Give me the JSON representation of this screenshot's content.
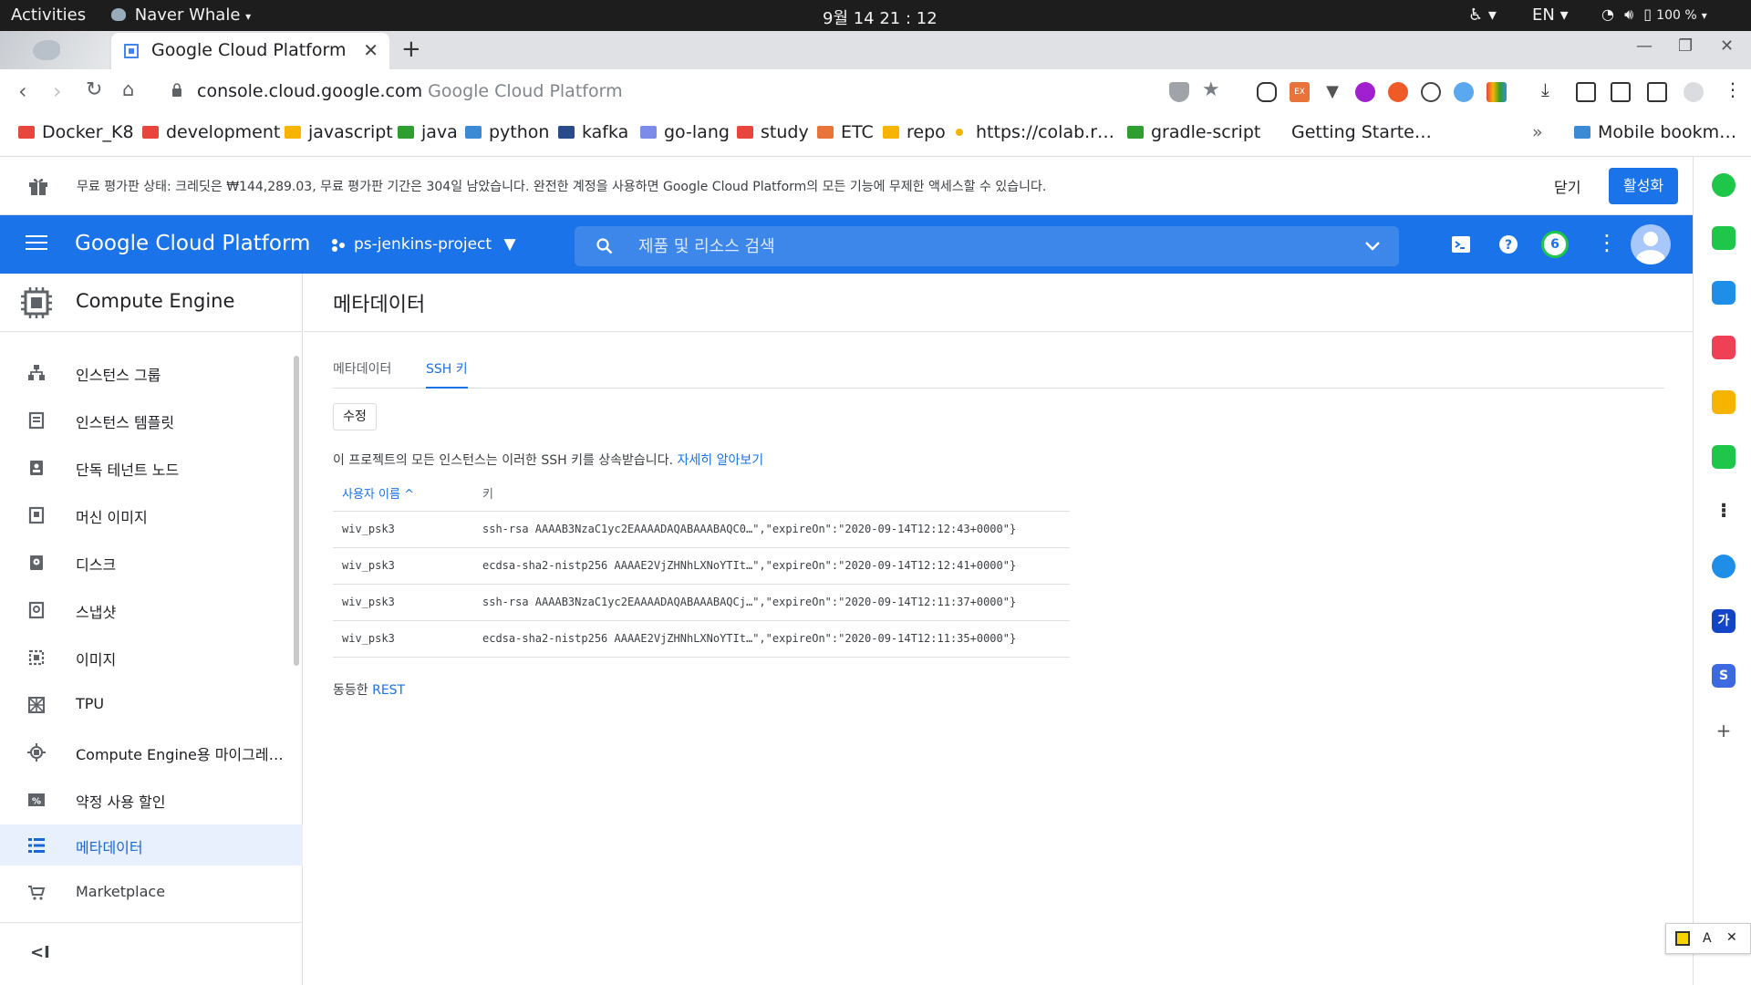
{
  "system": {
    "activities": "Activities",
    "app": "Naver Whale",
    "clock": "9월 14  21 : 12",
    "lang": "EN",
    "battery": "100 %"
  },
  "browser": {
    "tab_title": "Google Cloud Platform",
    "url_host": "console.cloud.google.com",
    "url_title": "Google Cloud Platform",
    "bookmarks": [
      {
        "label": "Docker_K8",
        "color": "#e8453c"
      },
      {
        "label": "development",
        "color": "#e8453c"
      },
      {
        "label": "javascript",
        "color": "#f6b400"
      },
      {
        "label": "java",
        "color": "#2e9e2e"
      },
      {
        "label": "python",
        "color": "#3a8ad6"
      },
      {
        "label": "kafka",
        "color": "#2b4a8b"
      },
      {
        "label": "go-lang",
        "color": "#7c8be8"
      },
      {
        "label": "study",
        "color": "#e8453c"
      },
      {
        "label": "ETC",
        "color": "#e8743c"
      },
      {
        "label": "repo",
        "color": "#f6b400"
      },
      {
        "label": "https://colab.r…",
        "color": "#f6b400"
      },
      {
        "label": "gradle-script",
        "color": "#2e9e2e"
      },
      {
        "label": "Getting Starte…",
        "color": ""
      }
    ],
    "more_bookmarks": "»",
    "mobile_bookmarks": "Mobile bookm…"
  },
  "banner": {
    "message": "무료 평가판 상태: 크레딧은 ₩144,289.03, 무료 평가판 기간은 304일 남았습니다. 완전한 계정을 사용하면 Google Cloud Platform의 모든 기능에 무제한 액세스할 수 있습니다.",
    "dismiss": "닫기",
    "activate": "활성화"
  },
  "header": {
    "brand": "Google Cloud Platform",
    "project": "ps-jenkins-project",
    "search_placeholder": "제품 및 리소스 검색",
    "notif_count": "6",
    "accent": "#1a73e8"
  },
  "leftnav": {
    "title": "Compute Engine",
    "items": [
      {
        "label": "인스턴스 그룹",
        "icon": "instance-group-icon"
      },
      {
        "label": "인스턴스 템플릿",
        "icon": "template-icon"
      },
      {
        "label": "단독 테넌트 노드",
        "icon": "sole-tenant-icon"
      },
      {
        "label": "머신 이미지",
        "icon": "machine-image-icon"
      },
      {
        "label": "디스크",
        "icon": "disk-icon"
      },
      {
        "label": "스냅샷",
        "icon": "snapshot-icon"
      },
      {
        "label": "이미지",
        "icon": "image-icon"
      },
      {
        "label": "TPU",
        "icon": "tpu-icon"
      },
      {
        "label": "Compute Engine용 마이그레…",
        "icon": "migrate-icon"
      },
      {
        "label": "약정 사용 할인",
        "icon": "discount-icon"
      },
      {
        "label": "메타데이터",
        "icon": "metadata-icon",
        "active": true
      },
      {
        "label": "Marketplace",
        "icon": "marketplace-icon"
      }
    ],
    "collapse": "<I"
  },
  "main": {
    "title": "메타데이터",
    "tabs": [
      "메타데이터",
      "SSH 키"
    ],
    "edit": "수정",
    "info": "이 프로젝트의 모든 인스턴스는 이러한 SSH 키를 상속받습니다.",
    "learn_more": "자세히 알아보기",
    "columns": [
      "사용자 이름",
      "키"
    ],
    "sort_arrow": "^",
    "rows": [
      {
        "user": "wiv_psk3",
        "key": "ssh-rsa AAAAB3NzaC1yc2EAAAADAQABAAABAQC0…\",\"expireOn\":\"2020-09-14T12:12:43+0000\"}"
      },
      {
        "user": "wiv_psk3",
        "key": "ecdsa-sha2-nistp256 AAAAE2VjZHNhLXNoYTIt…\",\"expireOn\":\"2020-09-14T12:12:41+0000\"}"
      },
      {
        "user": "wiv_psk3",
        "key": "ssh-rsa AAAAB3NzaC1yc2EAAAADAQABAAABAQCj…\",\"expireOn\":\"2020-09-14T12:11:37+0000\"}"
      },
      {
        "user": "wiv_psk3",
        "key": "ecdsa-sha2-nistp256 AAAAE2VjZHNhLXNoYTIt…\",\"expireOn\":\"2020-09-14T12:11:35+0000\"}"
      }
    ],
    "rest_prefix": "동등한",
    "rest_link": "REST"
  },
  "ime": {
    "char1": "A"
  },
  "whale_sidebar": [
    {
      "icon": "green-circle-icon",
      "color": "#1ec74a"
    },
    {
      "icon": "green-square-icon",
      "color": "#1ec74a"
    },
    {
      "icon": "calendar-icon",
      "color": "#1e8ee8"
    },
    {
      "icon": "pocket-icon",
      "color": "#ef4056"
    },
    {
      "icon": "star-icon",
      "color": "#f6b400"
    },
    {
      "icon": "bell-icon",
      "color": "#1ec74a"
    },
    {
      "icon": "apps-dots-icon",
      "color": "#333333"
    },
    {
      "icon": "edge-icon",
      "color": "#1e8ee8"
    },
    {
      "icon": "papago-icon",
      "color": "#1346c6"
    },
    {
      "icon": "s-icon",
      "color": "#3d6ae0"
    }
  ],
  "whale_sidebar_labels": {
    "papago": "가",
    "s": "S",
    "add": "+"
  }
}
